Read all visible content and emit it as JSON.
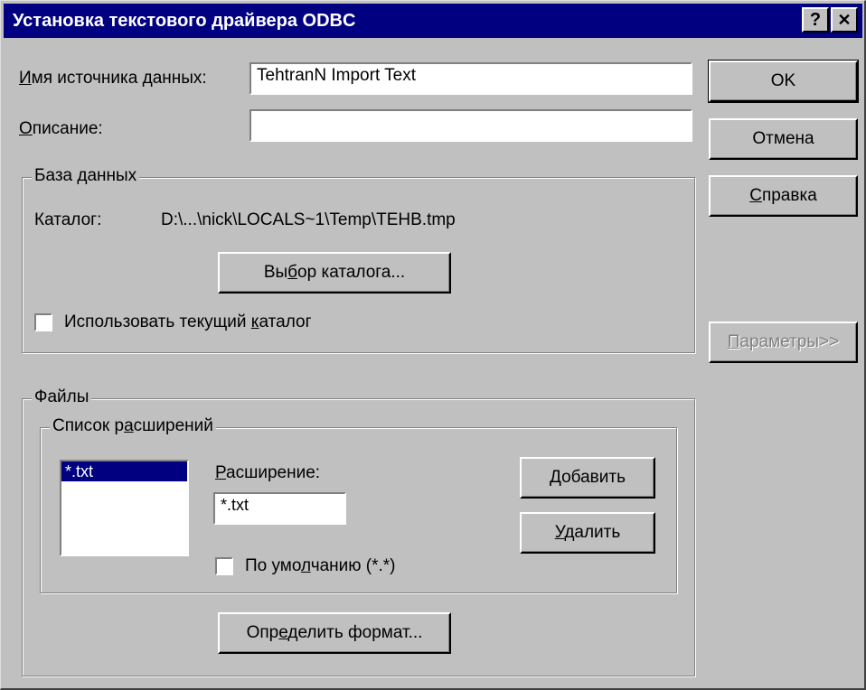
{
  "window": {
    "title": "Установка текстового драйвера ODBC",
    "help_button": "?",
    "close_button": "✕"
  },
  "fields": {
    "datasource": {
      "label": "Имя источника данных:",
      "label_accel": "И",
      "label_rest": "мя источника данных:",
      "value": "TehtranN Import Text"
    },
    "description": {
      "label": "Описание:",
      "label_accel": "О",
      "label_rest": "писание:",
      "value": ""
    }
  },
  "buttons": {
    "ok": "OK",
    "cancel": "Отмена",
    "help": {
      "accel": "С",
      "rest": "правка"
    },
    "options": {
      "accel": "П",
      "rest": "араметры>>"
    }
  },
  "database_group": {
    "title": "База данных",
    "catalog_label": "Каталог:",
    "catalog_value": "D:\\...\\nick\\LOCALS~1\\Temp\\TEHB.tmp",
    "select_button": {
      "pre": "Вы",
      "accel": "б",
      "post": "ор каталога..."
    },
    "use_current": {
      "pre": "Использовать текущий ",
      "accel": "к",
      "post": "аталог",
      "checked": false
    }
  },
  "files_group": {
    "title": "Файлы",
    "ext_group": {
      "title": {
        "pre": "Список р",
        "accel": "а",
        "post": "сширений"
      },
      "items": [
        "*.txt"
      ],
      "selected_index": 0,
      "ext_label": {
        "accel": "Р",
        "rest": "асширение:"
      },
      "ext_value": "*.txt",
      "add_button": {
        "accel": "Д",
        "rest": "обавить"
      },
      "delete_button": {
        "accel": "У",
        "rest": "далить"
      },
      "default_checkbox": {
        "pre": "По умо",
        "accel": "л",
        "post": "чанию (*.*)",
        "checked": false
      }
    },
    "format_button": {
      "pre": "Опр",
      "accel": "е",
      "post": "делить формат..."
    }
  }
}
